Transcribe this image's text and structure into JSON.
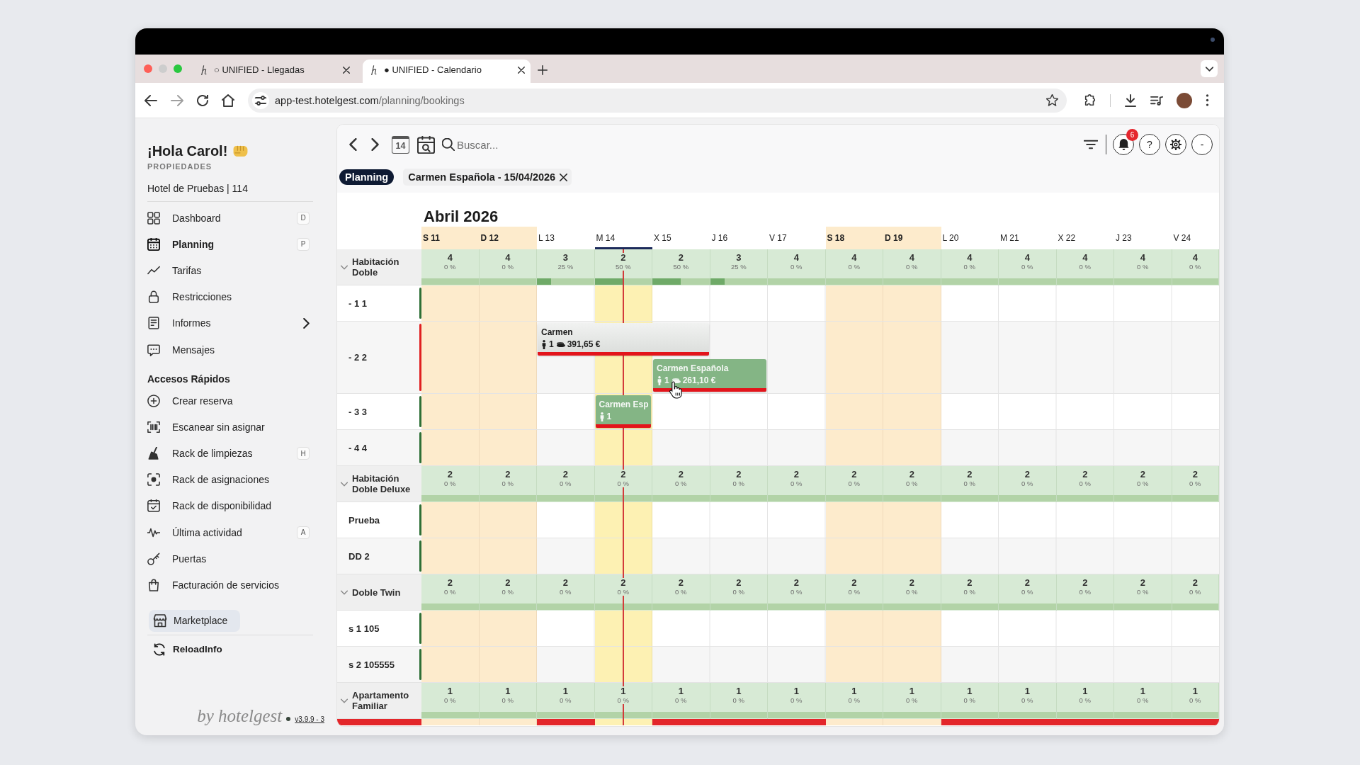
{
  "browser": {
    "tabs": [
      {
        "title": "○ UNIFIED - Llegadas",
        "selected": false
      },
      {
        "title": "● UNIFIED - Calendario",
        "selected": true
      }
    ],
    "url_host": "app-test.hotelgest.com",
    "url_path": "/planning/bookings"
  },
  "sidebar": {
    "greeting": "¡Hola Carol!",
    "section_label": "PROPIEDADES",
    "property": "Hotel de Pruebas | 114",
    "nav": [
      {
        "label": "Dashboard",
        "shortcut": "D",
        "selected": false,
        "submenu": false
      },
      {
        "label": "Planning",
        "shortcut": "P",
        "selected": true,
        "submenu": false
      },
      {
        "label": "Tarifas",
        "selected": false,
        "submenu": false
      },
      {
        "label": "Restricciones",
        "selected": false,
        "submenu": false
      },
      {
        "label": "Informes",
        "selected": false,
        "submenu": true
      },
      {
        "label": "Mensajes",
        "selected": false,
        "submenu": false
      }
    ],
    "quick_title": "Accesos Rápidos",
    "quick": [
      {
        "label": "Crear reserva"
      },
      {
        "label": "Escanear sin asignar"
      },
      {
        "label": "Rack de limpiezas",
        "shortcut": "H"
      },
      {
        "label": "Rack de asignaciones"
      },
      {
        "label": "Rack de disponibilidad"
      },
      {
        "label": "Última actividad",
        "shortcut": "A"
      },
      {
        "label": "Puertas"
      },
      {
        "label": "Facturación de servicios"
      }
    ],
    "marketplace": "Marketplace",
    "reload": "ReloadInfo",
    "brand": "by hotelgest",
    "version": "v3.9.9 - 3"
  },
  "toolbar": {
    "today_label": "14",
    "search_placeholder": "Buscar...",
    "notification_count": "6",
    "help_label": "?",
    "account_label": "-"
  },
  "chips": [
    {
      "label": "Planning",
      "kind": "view"
    },
    {
      "label": "Carmen Española - 15/04/2026",
      "kind": "filter"
    }
  ],
  "calendar": {
    "month": "Abril 2026",
    "days": [
      {
        "label": "S 11",
        "weekend": true,
        "today": false
      },
      {
        "label": "D 12",
        "weekend": true,
        "today": false
      },
      {
        "label": "L 13",
        "weekend": false,
        "today": false
      },
      {
        "label": "M 14",
        "weekend": false,
        "today": true
      },
      {
        "label": "X 15",
        "weekend": false,
        "today": false
      },
      {
        "label": "J 16",
        "weekend": false,
        "today": false
      },
      {
        "label": "V 17",
        "weekend": false,
        "today": false
      },
      {
        "label": "S 18",
        "weekend": true,
        "today": false
      },
      {
        "label": "D 19",
        "weekend": true,
        "today": false
      },
      {
        "label": "L 20",
        "weekend": false,
        "today": false
      },
      {
        "label": "M 21",
        "weekend": false,
        "today": false
      },
      {
        "label": "X 22",
        "weekend": false,
        "today": false
      },
      {
        "label": "J 23",
        "weekend": false,
        "today": false
      },
      {
        "label": "V 24",
        "weekend": false,
        "today": false
      }
    ],
    "groups": [
      {
        "name": "Habitación Doble",
        "expanded": true,
        "days": [
          {
            "count": "4",
            "percent": "0 %",
            "level": 0
          },
          {
            "count": "4",
            "percent": "0 %",
            "level": 0
          },
          {
            "count": "3",
            "percent": "25 %",
            "level": 0.25
          },
          {
            "count": "2",
            "percent": "50 %",
            "level": 0.5
          },
          {
            "count": "2",
            "percent": "50 %",
            "level": 0.5
          },
          {
            "count": "3",
            "percent": "25 %",
            "level": 0.25
          },
          {
            "count": "4",
            "percent": "0 %",
            "level": 0
          },
          {
            "count": "4",
            "percent": "0 %",
            "level": 0
          },
          {
            "count": "4",
            "percent": "0 %",
            "level": 0
          },
          {
            "count": "4",
            "percent": "0 %",
            "level": 0
          },
          {
            "count": "4",
            "percent": "0 %",
            "level": 0
          },
          {
            "count": "4",
            "percent": "0 %",
            "level": 0
          },
          {
            "count": "4",
            "percent": "0 %",
            "level": 0
          },
          {
            "count": "4",
            "percent": "0 %",
            "level": 0
          }
        ],
        "rooms": [
          {
            "name": "- 1 1",
            "color": "#2e6f36",
            "closed": false
          },
          {
            "name": "- 2 2",
            "color": "#e02020",
            "closed": false,
            "lanes": [
              {
                "days": [
                  {
                    "booked": false
                  },
                  {
                    "booked": false
                  },
                  {
                    "booked": true
                  },
                  {
                    "booked": true
                  },
                  {
                    "booked": true
                  },
                  {
                    "booked": false
                  },
                  {
                    "booked": false
                  },
                  {
                    "booked": false
                  },
                  {
                    "booked": false
                  },
                  {
                    "booked": false
                  },
                  {
                    "booked": false
                  },
                  {
                    "booked": false
                  },
                  {
                    "booked": false
                  },
                  {
                    "booked": false
                  }
                ],
                "bookings": [
                  {
                    "name": "Carmen",
                    "guests": "1",
                    "price": "391,65 €",
                    "kind": "pending",
                    "unpaid": true,
                    "hovered": false
                  }
                ]
              },
              {
                "days": [
                  {
                    "booked": false
                  },
                  {
                    "booked": false
                  },
                  {
                    "booked": false
                  },
                  {
                    "booked": false
                  },
                  {
                    "booked": true
                  },
                  {
                    "booked": true
                  },
                  {
                    "booked": false
                  },
                  {
                    "booked": false
                  },
                  {
                    "booked": false
                  },
                  {
                    "booked": false
                  },
                  {
                    "booked": false
                  },
                  {
                    "booked": false
                  },
                  {
                    "booked": false
                  },
                  {
                    "booked": false
                  }
                ],
                "bookings": [
                  {
                    "name": "Carmen Española",
                    "guests": "1",
                    "price": "261,10 €",
                    "kind": "confirmed",
                    "unpaid": true,
                    "hovered": true
                  }
                ]
              }
            ]
          },
          {
            "name": "- 3 3",
            "color": "#2e6f36",
            "closed": false,
            "lanes": [
              {
                "days": [
                  {
                    "booked": false
                  },
                  {
                    "booked": false
                  },
                  {
                    "booked": false
                  },
                  {
                    "booked": true
                  },
                  {
                    "booked": false
                  },
                  {
                    "booked": false
                  },
                  {
                    "booked": false
                  },
                  {
                    "booked": false
                  },
                  {
                    "booked": false
                  },
                  {
                    "booked": false
                  },
                  {
                    "booked": false
                  },
                  {
                    "booked": false
                  },
                  {
                    "booked": false
                  },
                  {
                    "booked": false
                  }
                ],
                "bookings": [
                  {
                    "name": "Carmen Esp",
                    "guests": "1",
                    "kind": "confirmed",
                    "unpaid": true,
                    "hovered": false
                  }
                ]
              }
            ]
          },
          {
            "name": "- 4 4",
            "color": "#2e6f36",
            "closed": false
          }
        ]
      },
      {
        "name": "Habitación Doble Deluxe",
        "expanded": true,
        "days": [
          {
            "count": "2",
            "percent": "0 %",
            "level": 0
          },
          {
            "count": "2",
            "percent": "0 %",
            "level": 0
          },
          {
            "count": "2",
            "percent": "0 %",
            "level": 0
          },
          {
            "count": "2",
            "percent": "0 %",
            "level": 0
          },
          {
            "count": "2",
            "percent": "0 %",
            "level": 0
          },
          {
            "count": "2",
            "percent": "0 %",
            "level": 0
          },
          {
            "count": "2",
            "percent": "0 %",
            "level": 0
          },
          {
            "count": "2",
            "percent": "0 %",
            "level": 0
          },
          {
            "count": "2",
            "percent": "0 %",
            "level": 0
          },
          {
            "count": "2",
            "percent": "0 %",
            "level": 0
          },
          {
            "count": "2",
            "percent": "0 %",
            "level": 0
          },
          {
            "count": "2",
            "percent": "0 %",
            "level": 0
          },
          {
            "count": "2",
            "percent": "0 %",
            "level": 0
          },
          {
            "count": "2",
            "percent": "0 %",
            "level": 0
          }
        ],
        "rooms": [
          {
            "name": "Prueba",
            "color": "#2e6f36",
            "closed": false
          },
          {
            "name": "DD 2",
            "color": "#2e6f36",
            "closed": false
          }
        ]
      },
      {
        "name": "Doble Twin",
        "expanded": true,
        "days": [
          {
            "count": "2",
            "percent": "0 %",
            "level": 0
          },
          {
            "count": "2",
            "percent": "0 %",
            "level": 0
          },
          {
            "count": "2",
            "percent": "0 %",
            "level": 0
          },
          {
            "count": "2",
            "percent": "0 %",
            "level": 0
          },
          {
            "count": "2",
            "percent": "0 %",
            "level": 0
          },
          {
            "count": "2",
            "percent": "0 %",
            "level": 0
          },
          {
            "count": "2",
            "percent": "0 %",
            "level": 0
          },
          {
            "count": "2",
            "percent": "0 %",
            "level": 0
          },
          {
            "count": "2",
            "percent": "0 %",
            "level": 0
          },
          {
            "count": "2",
            "percent": "0 %",
            "level": 0
          },
          {
            "count": "2",
            "percent": "0 %",
            "level": 0
          },
          {
            "count": "2",
            "percent": "0 %",
            "level": 0
          },
          {
            "count": "2",
            "percent": "0 %",
            "level": 0
          },
          {
            "count": "2",
            "percent": "0 %",
            "level": 0
          }
        ],
        "rooms": [
          {
            "name": "s 1 105",
            "color": "#2e6f36",
            "closed": false
          },
          {
            "name": "s 2 105555",
            "color": "#2e6f36",
            "closed": false
          }
        ]
      },
      {
        "name": "Apartamento Familiar",
        "expanded": true,
        "days": [
          {
            "count": "1",
            "percent": "0 %",
            "level": 0
          },
          {
            "count": "1",
            "percent": "0 %",
            "level": 0
          },
          {
            "count": "1",
            "percent": "0 %",
            "level": 0
          },
          {
            "count": "1",
            "percent": "0 %",
            "level": 0
          },
          {
            "count": "1",
            "percent": "0 %",
            "level": 0
          },
          {
            "count": "1",
            "percent": "0 %",
            "level": 0
          },
          {
            "count": "1",
            "percent": "0 %",
            "level": 0
          },
          {
            "count": "1",
            "percent": "0 %",
            "level": 0
          },
          {
            "count": "1",
            "percent": "0 %",
            "level": 0
          },
          {
            "count": "1",
            "percent": "0 %",
            "level": 0
          },
          {
            "count": "1",
            "percent": "0 %",
            "level": 0
          },
          {
            "count": "1",
            "percent": "0 %",
            "level": 0
          },
          {
            "count": "1",
            "percent": "0 %",
            "level": 0
          },
          {
            "count": "1",
            "percent": "0 %",
            "level": 0
          }
        ],
        "rooms": [
          {
            "closed": true
          }
        ]
      }
    ]
  }
}
